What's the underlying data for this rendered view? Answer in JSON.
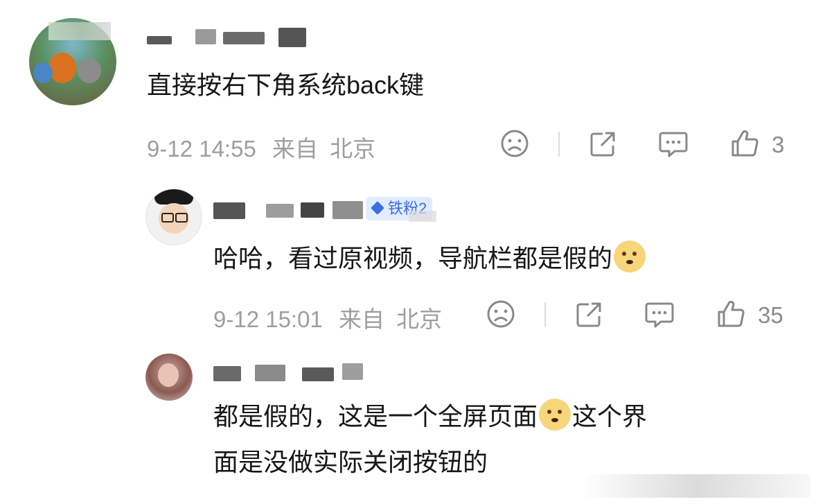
{
  "comments": [
    {
      "text": "直接按右下角系统back键",
      "time": "9-12 14:55",
      "location_prefix": "来自",
      "location": "北京",
      "likes": "3"
    },
    {
      "badge": "铁粉2",
      "text_part1": "哈哈，看过原视频，导航栏都是假的",
      "emoji_name": "doge",
      "time": "9-12 15:01",
      "location_prefix": "来自",
      "location": "北京",
      "likes": "35"
    },
    {
      "line1_part1": "都是假的，这是一个全屏页面",
      "emoji_name": "doge",
      "line1_part2": "这个界",
      "line2": "面是没做实际关闭按钮的"
    }
  ],
  "icons": [
    "sad-face-icon",
    "share-icon",
    "comment-icon",
    "thumbs-up-icon"
  ],
  "colors": {
    "text": "#161616",
    "meta": "#9e9e9e",
    "badge_bg": "#e3ecff",
    "badge_text": "#3b6fe0"
  }
}
